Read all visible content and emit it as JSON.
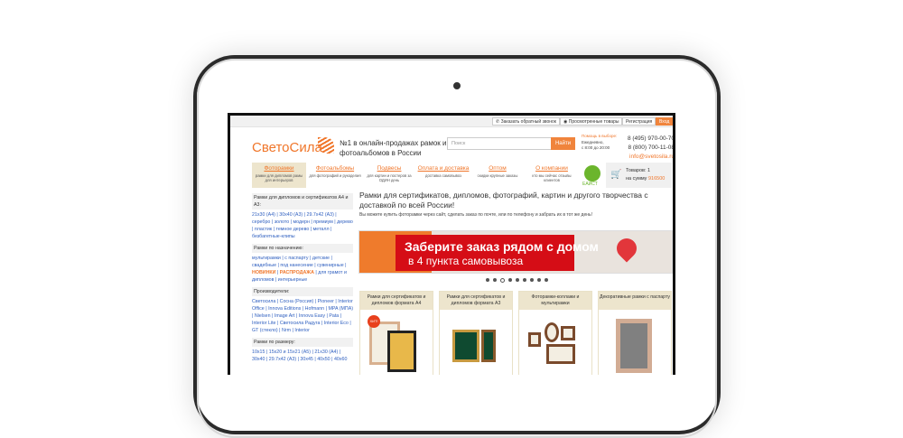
{
  "topbar": {
    "callback": "Заказать обратный звонок",
    "viewed": "Просмотренные товары",
    "register": "Регистрация",
    "login": "Вход"
  },
  "header": {
    "logo": "СветоСила",
    "slogan": "№1 в онлайн-продажах рамок и фотоальбомов в России",
    "search_placeholder": "Поиск",
    "search_button": "Найти",
    "help_title": "Помощь в выборе:",
    "help_days": "Ежедневно,",
    "help_hours": "с 8:00 до 20:00",
    "phone1": "8 (495) 970-00-70",
    "phone2": "8 (800) 700-11-08",
    "email": "info@svetosila.ru"
  },
  "nav": [
    {
      "label": "Фоторамки",
      "sub": "рамки для дипломов рамы для интерьеров"
    },
    {
      "label": "Фотоальбомы",
      "sub": "для фотографий и рукоделия"
    },
    {
      "label": "Подвесы",
      "sub": "для картин и постеров за ОДИН день"
    },
    {
      "label": "Оплата и доставка",
      "sub": "доставка самовывоз"
    },
    {
      "label": "Оптом",
      "sub": "скидки крупные заказы"
    },
    {
      "label": "О компании",
      "sub": "кто мы сейчас отзывы клиентов"
    }
  ],
  "eaist": "ЕАИСТ",
  "cart": {
    "items": "Товаров: 1",
    "sum_label": "на сумму",
    "sum": "916500"
  },
  "sidebar": [
    {
      "title": "Рамки для дипломов и сертификатов А4 и А3:",
      "links": [
        "21x30 (A4)",
        "30x40 (A3)",
        "29.7x42 (A3)",
        "серебро",
        "золото",
        "модерн",
        "премиум",
        "дерево",
        "пластик",
        "темное дерево",
        "металл",
        "безбагетные-клипы"
      ]
    },
    {
      "title": "Рамки по назначению:",
      "links": [
        "мультирамки",
        "с паспарту",
        "детские",
        "свадебные",
        "под нанесение",
        "сувенирные",
        "НОВИНКИ",
        "РАСПРОДАЖА",
        "для грамот и дипломов",
        "интерьерные"
      ]
    },
    {
      "title": "Производители:",
      "links": [
        "Светосила",
        "Сосна (Россия)",
        "Pioneer",
        "Interior Office",
        "Innova Editions",
        "Hofmann",
        "MPA (МПА)",
        "Nielsen",
        "Image Art",
        "Innova Easy",
        "Pata",
        "Interior Lite",
        "Светосила Радуга",
        "Interior Eco",
        "GT (стекло)",
        "Nrm",
        "Interior"
      ]
    },
    {
      "title": "Рамки по размеру:",
      "links": [
        "10x15",
        "15x20 и 15x21 (A5)",
        "21x30 (A4)",
        "30x40",
        "29.7x42 (A3)",
        "30x45",
        "40x50",
        "40x60"
      ]
    }
  ],
  "main": {
    "title": "Рамки для сертификатов, дипломов, фотографий, картин и другого творчества с доставкой по всей России!",
    "subtitle": "Вы можете купить фоторамки через сайт, сделать заказ по почте, или по телефону и забрать их в тот же день!",
    "banner_line1": "Заберите заказ рядом с домом",
    "banner_line2": "в 4 пункта самовывоза",
    "slide_count": 9,
    "active_slide": 3,
    "cards": [
      "Рамки для сертификатов и дипломов формата А4",
      "Рамки для сертификатов и дипломов формата А3",
      "Фоторамки-коллажи и мультирамки",
      "Декоративные рамки с паспарту"
    ],
    "hit_badge": "ХИТ!"
  }
}
